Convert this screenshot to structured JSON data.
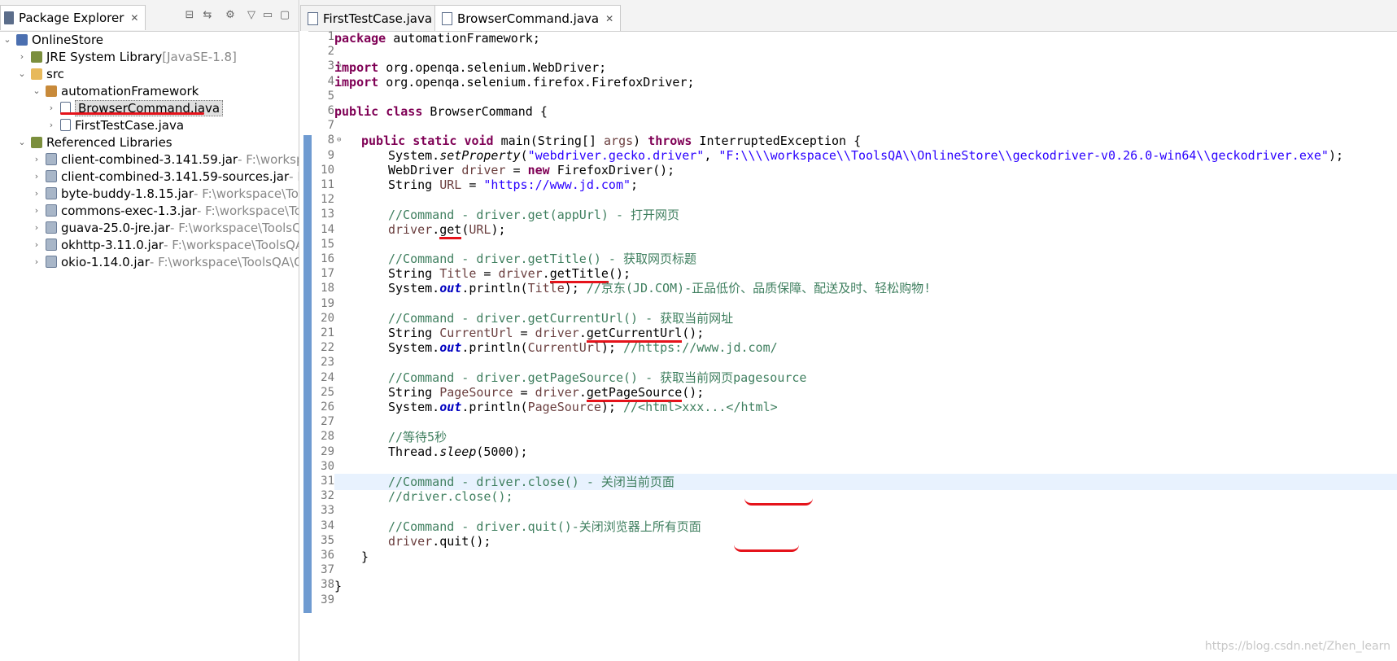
{
  "explorer": {
    "tab_label": "Package Explorer",
    "tree": [
      {
        "label": "OnlineStore",
        "suffix": "",
        "icon": "project-icon",
        "depth": 0,
        "chevron": "v"
      },
      {
        "label": "JRE System Library",
        "suffix": "[JavaSE-1.8]",
        "icon": "library-icon",
        "depth": 1,
        "chevron": ">"
      },
      {
        "label": "src",
        "suffix": "",
        "icon": "source-folder-icon",
        "depth": 1,
        "chevron": "v"
      },
      {
        "label": "automationFramework",
        "suffix": "",
        "icon": "package-icon",
        "depth": 2,
        "chevron": "v"
      },
      {
        "label": "BrowserCommand.java",
        "suffix": "",
        "icon": "java-file-icon",
        "depth": 3,
        "chevron": ">"
      },
      {
        "label": "FirstTestCase.java",
        "suffix": "",
        "icon": "java-file-icon",
        "depth": 3,
        "chevron": ">"
      },
      {
        "label": "Referenced Libraries",
        "suffix": "",
        "icon": "library-icon",
        "depth": 1,
        "chevron": "v"
      },
      {
        "label": "client-combined-3.141.59.jar",
        "suffix": "- F:\\workspace",
        "icon": "jar-icon",
        "depth": 2,
        "chevron": ">"
      },
      {
        "label": "client-combined-3.141.59-sources.jar",
        "suffix": "- F:\\w",
        "icon": "jar-icon",
        "depth": 2,
        "chevron": ">"
      },
      {
        "label": "byte-buddy-1.8.15.jar",
        "suffix": "- F:\\workspace\\Tools",
        "icon": "jar-icon",
        "depth": 2,
        "chevron": ">"
      },
      {
        "label": "commons-exec-1.3.jar",
        "suffix": "- F:\\workspace\\Tools",
        "icon": "jar-icon",
        "depth": 2,
        "chevron": ">"
      },
      {
        "label": "guava-25.0-jre.jar",
        "suffix": "- F:\\workspace\\ToolsQA\\",
        "icon": "jar-icon",
        "depth": 2,
        "chevron": ">"
      },
      {
        "label": "okhttp-3.11.0.jar",
        "suffix": "- F:\\workspace\\ToolsQA\\O",
        "icon": "jar-icon",
        "depth": 2,
        "chevron": ">"
      },
      {
        "label": "okio-1.14.0.jar",
        "suffix": "- F:\\workspace\\ToolsQA\\Onli",
        "icon": "jar-icon",
        "depth": 2,
        "chevron": ">"
      }
    ],
    "selected_item": "BrowserCommand.java"
  },
  "editor": {
    "tabs": [
      {
        "label": "FirstTestCase.java",
        "active": false
      },
      {
        "label": "BrowserCommand.java",
        "active": true
      }
    ],
    "current_line": 31,
    "line_count": 39,
    "code": {
      "l1": [
        "package",
        " automationFramework;"
      ],
      "l3": [
        "import",
        " org.openqa.selenium.WebDriver;"
      ],
      "l4": [
        "import",
        " org.openqa.selenium.firefox.FirefoxDriver;"
      ],
      "l6": [
        "public",
        "class",
        " BrowserCommand {"
      ],
      "l8": [
        "public",
        "static",
        "void",
        " main(String[] ",
        "args",
        ") ",
        "throws",
        " InterruptedException {"
      ],
      "l9": [
        "System.",
        "setProperty",
        "(",
        "\"webdriver.gecko.driver\"",
        ", ",
        "\"F:\\\\\\\\workspace\\\\ToolsQA\\\\OnlineStore\\\\geckodriver-v0.26.0-win64\\\\geckodriver.exe\"",
        ");"
      ],
      "l10": [
        "WebDriver ",
        "driver",
        " = ",
        "new",
        " FirefoxDriver();"
      ],
      "l11": [
        "String ",
        "URL",
        " = ",
        "\"https://www.jd.com\"",
        ";"
      ],
      "l13": "//Command - driver.get(appUrl) - 打开网页",
      "l14": [
        "driver",
        ".",
        "get",
        "(",
        "URL",
        ");"
      ],
      "l16": "//Command - driver.getTitle() - 获取网页标题",
      "l17": [
        "String ",
        "Title",
        " = ",
        "driver",
        ".",
        "getTitle",
        "();"
      ],
      "l18": [
        "System.",
        "out",
        ".println(",
        "Title",
        "); ",
        "//京东(JD.COM)-正品低价、品质保障、配送及时、轻松购物!"
      ],
      "l20": "//Command - driver.getCurrentUrl() - 获取当前网址",
      "l21": [
        "String ",
        "CurrentUrl",
        " = ",
        "driver",
        ".",
        "getCurrentUrl",
        "();"
      ],
      "l22": [
        "System.",
        "out",
        ".println(",
        "CurrentUrl",
        "); ",
        "//https://www.jd.com/"
      ],
      "l24": "//Command - driver.getPageSource() - 获取当前网页pagesource",
      "l25": [
        "String ",
        "PageSource",
        " = ",
        "driver",
        ".",
        "getPageSource",
        "();"
      ],
      "l26": [
        "System.",
        "out",
        ".println(",
        "PageSource",
        "); ",
        "//<html>xxx...</html>"
      ],
      "l28": "//等待5秒",
      "l29": [
        "Thread.",
        "sleep",
        "(5000);"
      ],
      "l31": "//Command - driver.close() - 关闭当前页面",
      "l32": "//driver.close();",
      "l34": "//Command - driver.quit()-关闭浏览器上所有页面",
      "l35": [
        "driver",
        ".",
        "quit",
        "();"
      ],
      "l36": "}",
      "l38": "}"
    }
  },
  "watermark": "https://blog.csdn.net/Zhen_learn"
}
